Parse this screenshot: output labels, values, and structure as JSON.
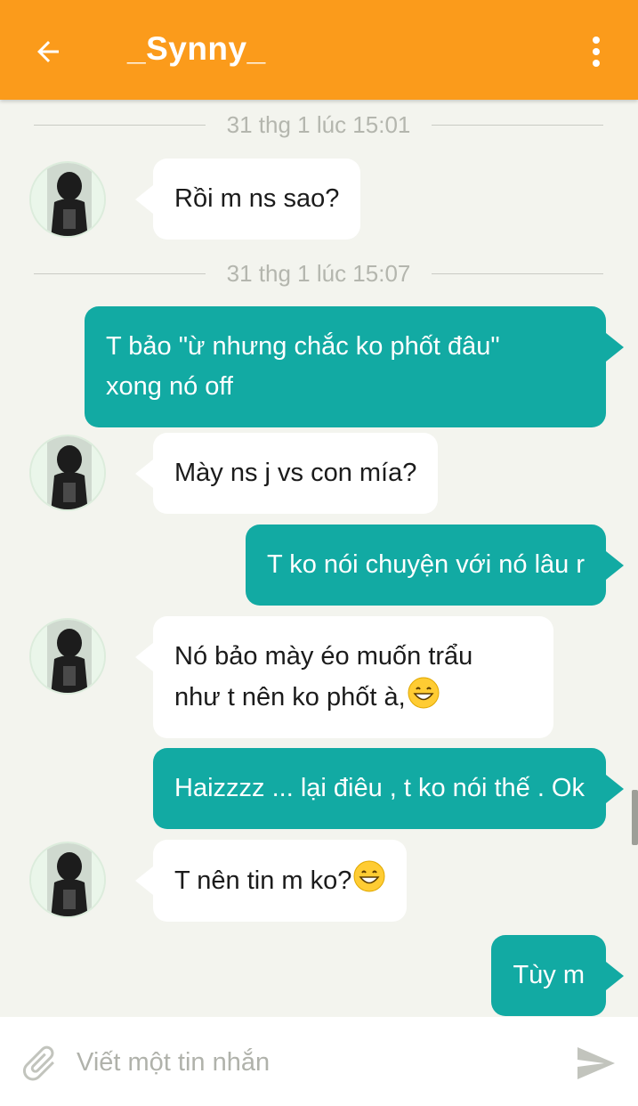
{
  "header": {
    "title": "_Synny_",
    "back_icon": "arrow-left-icon",
    "menu_icon": "more-vertical-icon",
    "background": "#fb9b1b"
  },
  "dividers": [
    {
      "date": "31 thg 1 lúc 15:01"
    },
    {
      "date": "31 thg 1 lúc 15:07"
    }
  ],
  "messages": [
    {
      "direction": "in",
      "text": "Rồi m ns sao?",
      "avatar": "contact-avatar"
    },
    {
      "direction": "out",
      "line1": "T bảo \"ừ nhưng chắc ko phốt đâu\"",
      "line2": "xong nó off"
    },
    {
      "direction": "in",
      "text": "Mày ns j vs con mía?",
      "avatar": "contact-avatar"
    },
    {
      "direction": "out",
      "text": "T ko nói chuyện với nó lâu r"
    },
    {
      "direction": "in",
      "line1": "Nó bảo mày éo muốn trẩu",
      "line2": "như t nên ko phốt à,",
      "emoji": "grinning-face-emoji",
      "avatar": "contact-avatar"
    },
    {
      "direction": "out",
      "text": "Haizzzz ... lại điêu , t ko nói thế . Ok"
    },
    {
      "direction": "in",
      "text": "T nên tin m ko?",
      "emoji": "grinning-face-emoji",
      "avatar": "contact-avatar"
    },
    {
      "direction": "out",
      "text": "Tùy m"
    }
  ],
  "composer": {
    "placeholder": "Viết một tin nhắn",
    "attach_icon": "paperclip-icon",
    "send_icon": "send-icon"
  },
  "colors": {
    "outgoing_bubble": "#12aaa3",
    "incoming_bubble": "#ffffff",
    "chat_background": "#f3f4ee"
  }
}
